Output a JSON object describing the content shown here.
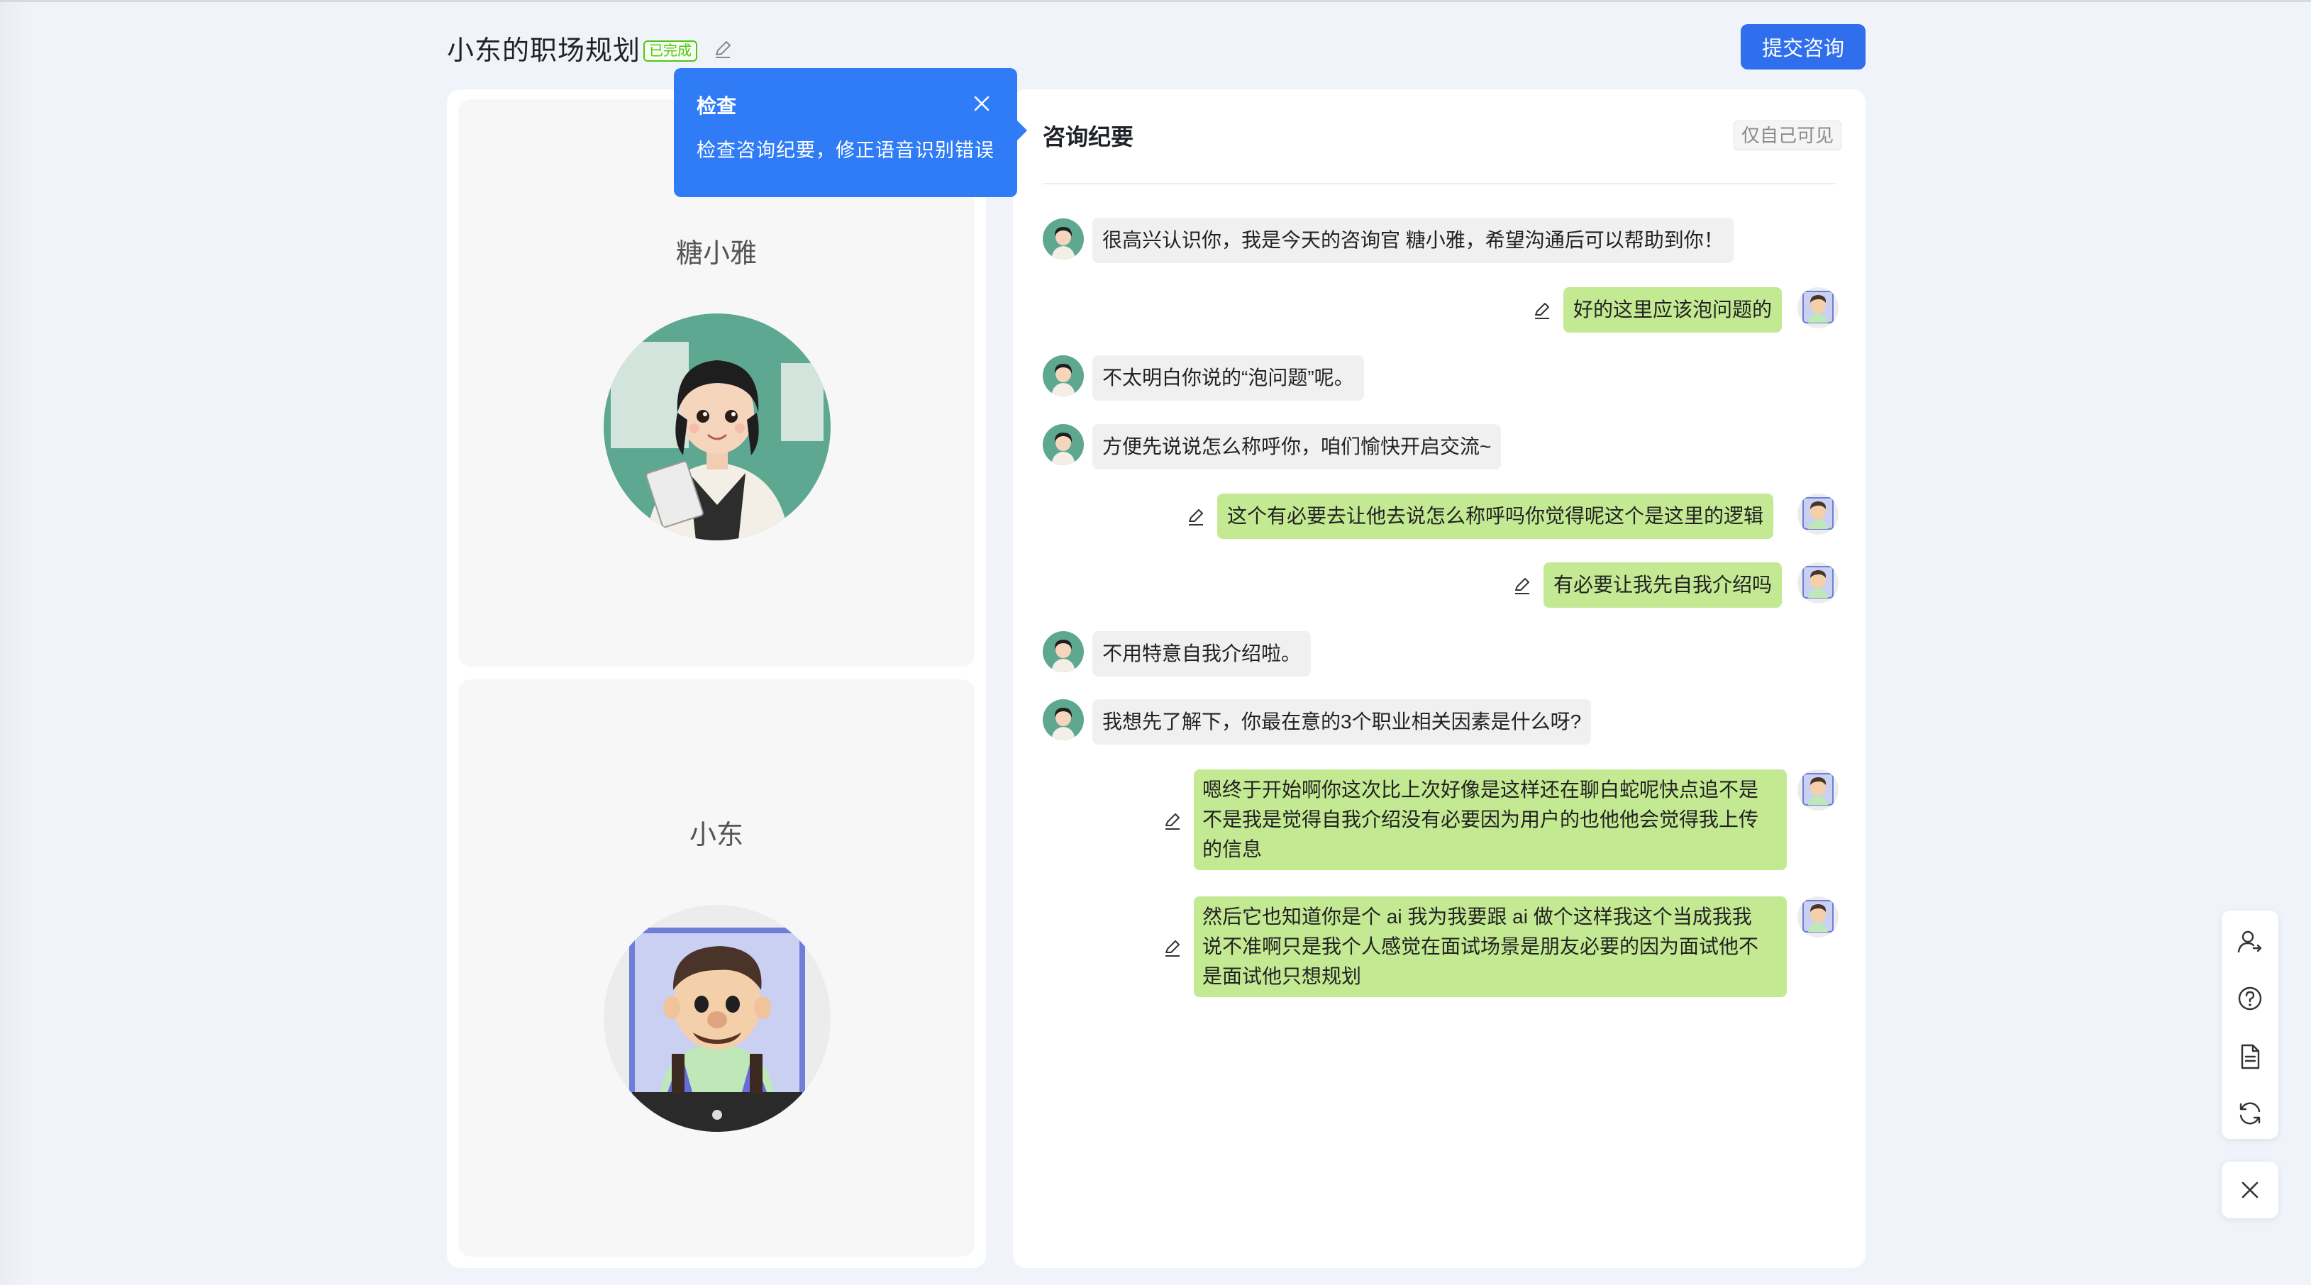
{
  "header": {
    "title": "小东的职场规划",
    "status": "已完成",
    "submit_label": "提交咨询"
  },
  "left_panel": {
    "consultant_name": "糖小雅",
    "user_name": "小东"
  },
  "tooltip": {
    "title": "检查",
    "text": "检查咨询纪要，修正语音识别错误"
  },
  "transcript": {
    "title": "咨询纪要",
    "visibility": "仅自己可见",
    "messages": [
      {
        "role": "bot",
        "text": "很高兴认识你，我是今天的咨询官 糖小雅，希望沟通后可以帮助到你！"
      },
      {
        "role": "user",
        "text": "好的这里应该泡问题的"
      },
      {
        "role": "bot",
        "text": "不太明白你说的“泡问题”呢。"
      },
      {
        "role": "bot",
        "text": "方便先说说怎么称呼你，咱们愉快开启交流~"
      },
      {
        "role": "user",
        "text": "这个有必要去让他去说怎么称呼吗你觉得呢这个是这里的逻辑"
      },
      {
        "role": "user",
        "text": "有必要让我先自我介绍吗"
      },
      {
        "role": "bot",
        "text": "不用特意自我介绍啦。"
      },
      {
        "role": "bot",
        "text": "我想先了解下，你最在意的3个职业相关因素是什么呀?"
      },
      {
        "role": "user",
        "lines": [
          "嗯终于开始啊你这次比上次好像是这样还在聊白蛇呢快点追不是",
          "不是我是觉得自我介绍没有必要因为用户的也他他会觉得我上传",
          "的信息"
        ]
      },
      {
        "role": "user",
        "lines": [
          "然后它也知道你是个 ai 我为我要跟 ai 做个这样我这个当成我我",
          "说不准啊只是我个人感觉在面试场景是朋友必要的因为面试他不",
          "是面试他只想规划"
        ]
      }
    ]
  },
  "colors": {
    "primary": "#2f6fed",
    "user_bubble": "#c4e993",
    "bot_bubble": "#f0f0f0",
    "done_green": "#52c41a"
  },
  "icons": {
    "title_edit": "pencil-icon",
    "tooltip_close": "close-icon",
    "tools": [
      "user-switch-icon",
      "help-icon",
      "document-icon",
      "refresh-icon"
    ],
    "side_close": "close-icon"
  }
}
